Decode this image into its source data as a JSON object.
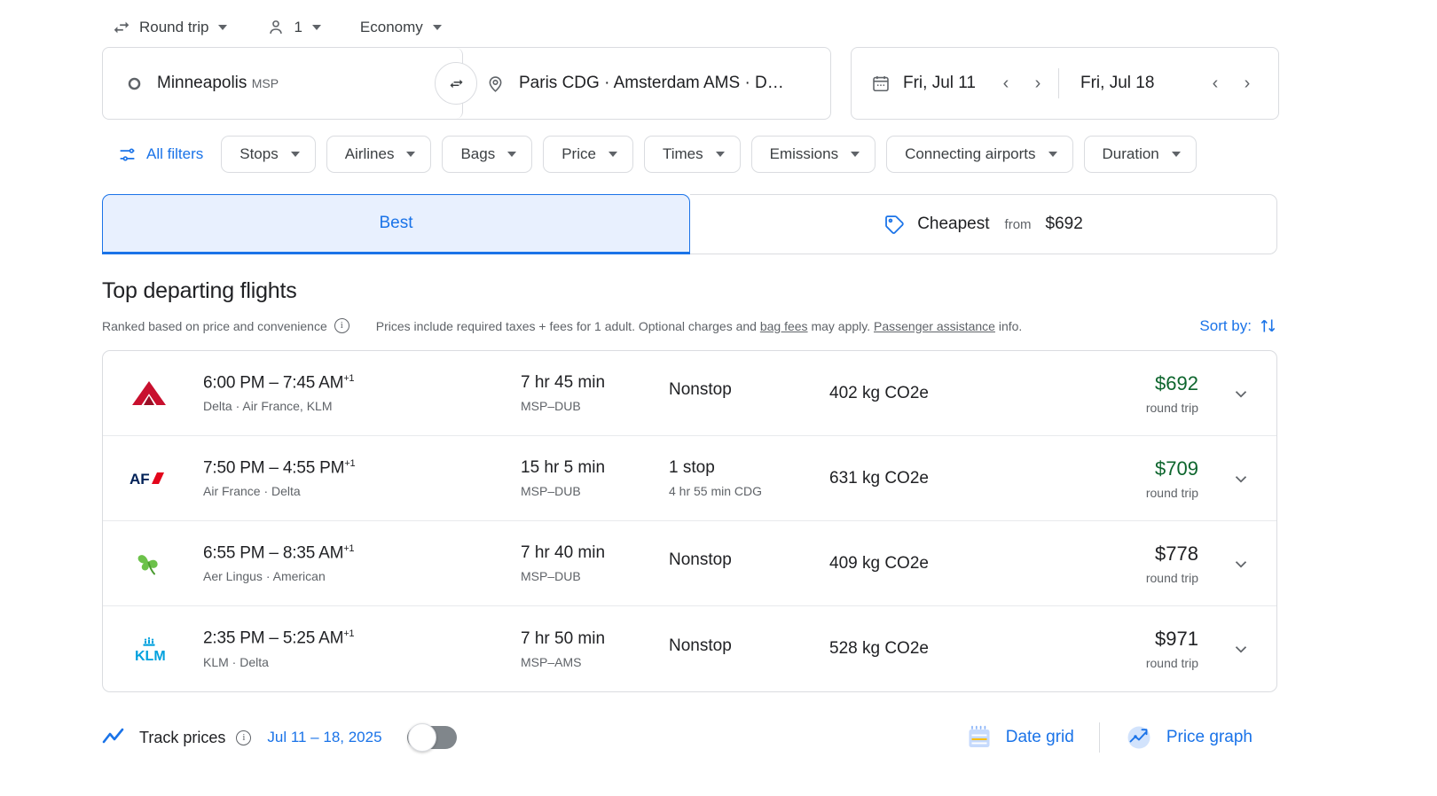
{
  "trip_options": {
    "trip_type": {
      "label": "Round trip",
      "icon": "swap-horizontal-icon"
    },
    "passengers": {
      "label": "1",
      "icon": "person-icon"
    },
    "cabin": {
      "label": "Economy"
    }
  },
  "search": {
    "origin": {
      "city": "Minneapolis",
      "code": "MSP",
      "icon": "circle-outline-icon"
    },
    "destination": {
      "text": "Paris CDG · Amsterdam AMS · D…",
      "icon": "map-pin-icon"
    },
    "swap_icon": "swap-arrows-icon",
    "depart_date": "Fri, Jul 11",
    "return_date": "Fri, Jul 18",
    "calendar_icon": "calendar-icon",
    "prev_label": "‹",
    "next_label": "›"
  },
  "filters": {
    "all_filters": "All filters",
    "all_filters_icon": "tune-icon",
    "chips": [
      "Stops",
      "Airlines",
      "Bags",
      "Price",
      "Times",
      "Emissions",
      "Connecting airports",
      "Duration"
    ]
  },
  "tabs": {
    "best": "Best",
    "cheapest": "Cheapest",
    "cheapest_from": "from",
    "cheapest_price": "$692",
    "cheapest_icon": "price-tag-icon"
  },
  "section": {
    "title": "Top departing flights",
    "ranked_note": "Ranked based on price and convenience",
    "info_icon": "info-icon",
    "price_note_pre": "Prices include required taxes + fees for 1 adult. Optional charges and ",
    "price_note_link1": "bag fees",
    "price_note_mid": " may apply. ",
    "price_note_link2": "Passenger assistance",
    "price_note_post": " info.",
    "sort_by": "Sort by:",
    "sort_icon": "sort-arrows-icon"
  },
  "columns": [
    "times",
    "duration",
    "stops",
    "emissions",
    "price"
  ],
  "flights": [
    {
      "logo": "delta-logo",
      "times": "6:00 PM – 7:45 AM",
      "day_offset": "+1",
      "carriers": "Delta · Air France, KLM",
      "duration": "7 hr 45 min",
      "route": "MSP–DUB",
      "stops": "Nonstop",
      "stop_detail": "",
      "emissions": "402 kg CO2e",
      "price": "$692",
      "price_is_green": true,
      "price_note": "round trip",
      "expand_icon": "chevron-down-icon"
    },
    {
      "logo": "airfrance-logo",
      "times": "7:50 PM – 4:55 PM",
      "day_offset": "+1",
      "carriers": "Air France · Delta",
      "duration": "15 hr 5 min",
      "route": "MSP–DUB",
      "stops": "1 stop",
      "stop_detail": "4 hr 55 min CDG",
      "emissions": "631 kg CO2e",
      "price": "$709",
      "price_is_green": true,
      "price_note": "round trip",
      "expand_icon": "chevron-down-icon"
    },
    {
      "logo": "aerlingus-logo",
      "times": "6:55 PM – 8:35 AM",
      "day_offset": "+1",
      "carriers": "Aer Lingus · American",
      "duration": "7 hr 40 min",
      "route": "MSP–DUB",
      "stops": "Nonstop",
      "stop_detail": "",
      "emissions": "409 kg CO2e",
      "price": "$778",
      "price_is_green": false,
      "price_note": "round trip",
      "expand_icon": "chevron-down-icon"
    },
    {
      "logo": "klm-logo",
      "times": "2:35 PM – 5:25 AM",
      "day_offset": "+1",
      "carriers": "KLM · Delta",
      "duration": "7 hr 50 min",
      "route": "MSP–AMS",
      "stops": "Nonstop",
      "stop_detail": "",
      "emissions": "528 kg CO2e",
      "price": "$971",
      "price_is_green": false,
      "price_note": "round trip",
      "expand_icon": "chevron-down-icon"
    }
  ],
  "footer": {
    "track_prices": "Track prices",
    "track_icon": "trend-line-icon",
    "info_icon": "info-icon",
    "track_dates": "Jul 11 – 18, 2025",
    "toggle_state": "off",
    "date_grid": "Date grid",
    "date_grid_icon": "date-grid-icon",
    "price_graph": "Price graph",
    "price_graph_icon": "price-graph-icon"
  },
  "colors": {
    "accent": "#1a73e8",
    "accent_bg": "#e8f0fe",
    "green_price": "#0d652d",
    "border": "#dadce0",
    "text": "#202124",
    "muted": "#5f6368"
  }
}
